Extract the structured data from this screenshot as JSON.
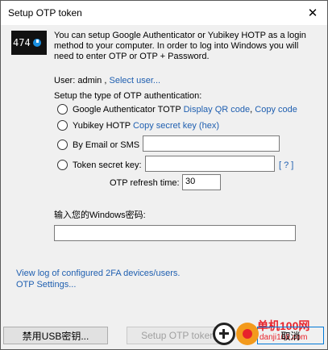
{
  "window": {
    "title": "Setup OTP token",
    "close_glyph": "✕"
  },
  "logo": {
    "text": "474",
    "icon": "otp-clock-icon"
  },
  "intro": {
    "text": "You can setup Google Authenticator or Yubikey HOTP as a login method to your computer. In order to log into Windows you will need to enter OTP or OTP + Password."
  },
  "user": {
    "label": "User: admin ,",
    "select_link": "Select user..."
  },
  "setup_type_label": "Setup the type of OTP authentication:",
  "options": {
    "google": {
      "label": "Google Authenticator TOTP",
      "qr_link": "Display QR code",
      "separator": ",",
      "copy_link": "Copy code"
    },
    "yubikey": {
      "label": "Yubikey HOTP",
      "copy_link": "Copy secret key (hex)"
    },
    "email": {
      "label": "By Email or SMS :",
      "value": ""
    },
    "secret": {
      "label": "Token secret key:",
      "value": "",
      "help_link": "[ ? ]"
    }
  },
  "refresh": {
    "label": "OTP refresh time:",
    "value": "30"
  },
  "password": {
    "label": "输入您的Windows密码:",
    "value": ""
  },
  "links": {
    "view_log": "View log of configured 2FA devices/users.",
    "settings": "OTP Settings..."
  },
  "buttons": {
    "usb": "禁用USB密钥...",
    "setup": "Setup OTP token",
    "cancel": "取消"
  },
  "watermark": {
    "line1": "单机100网",
    "line2": "danji100.com"
  },
  "colors": {
    "link": "#1f5fb0",
    "accent": "#0078d7",
    "watermark": "#e8232b"
  }
}
